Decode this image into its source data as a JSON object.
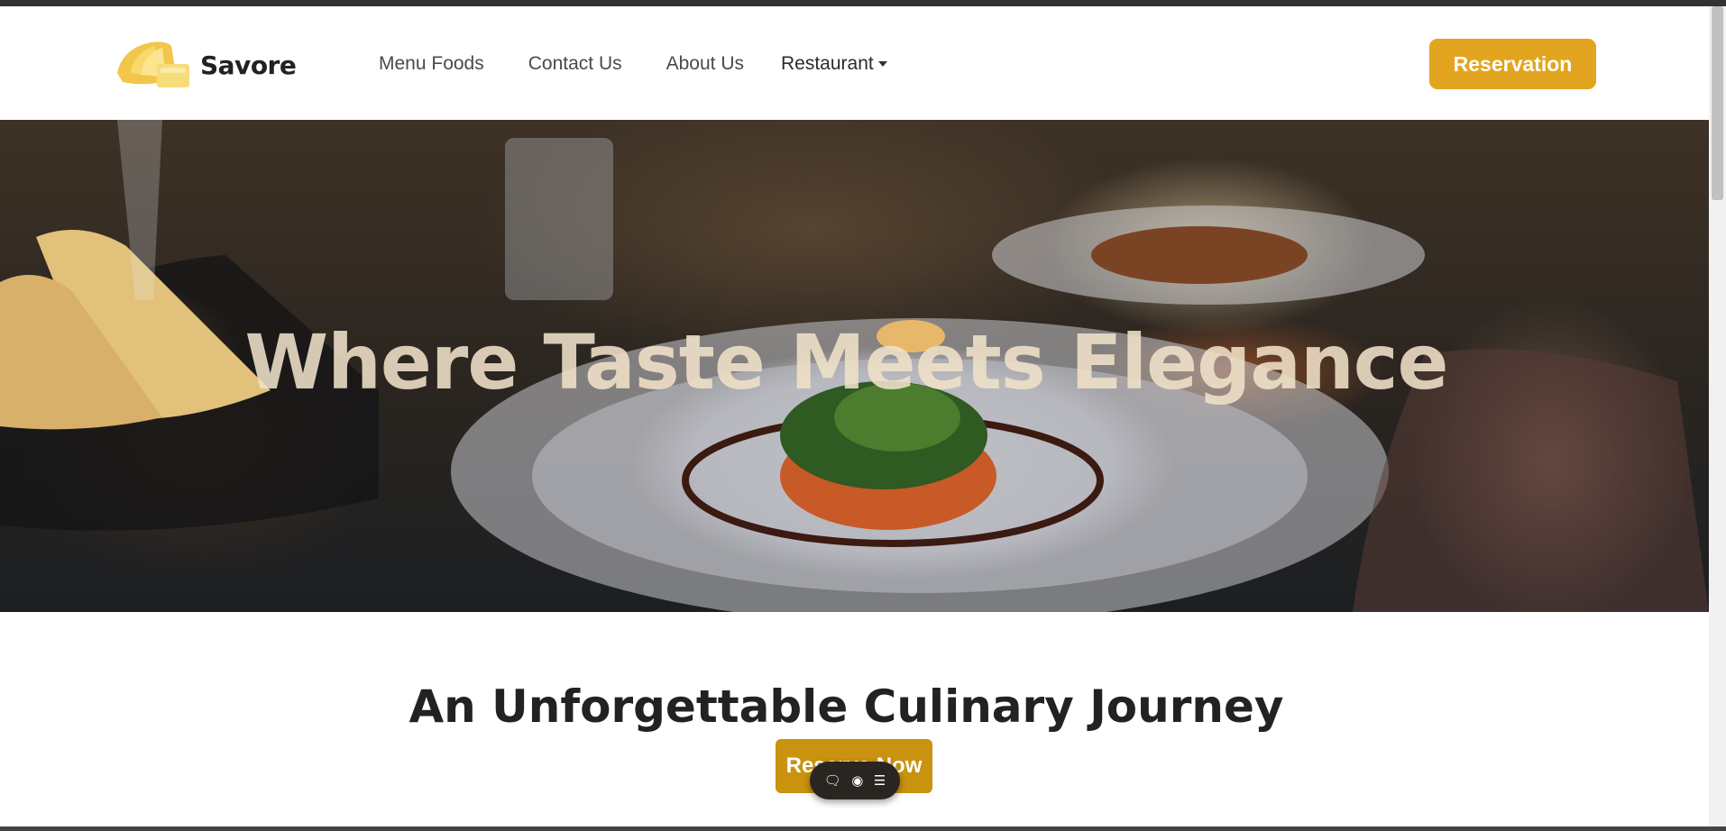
{
  "header": {
    "brand_name": "Savore",
    "logo_icon": "butter-logo-icon",
    "nav_items": [
      {
        "label": "Menu Foods"
      },
      {
        "label": "Contact Us"
      },
      {
        "label": "About Us"
      }
    ],
    "dropdown": {
      "label": "Restaurant"
    },
    "reservation_label": "Reservation"
  },
  "hero": {
    "title": "Where Taste Meets Elegance"
  },
  "content": {
    "heading": "An Unforgettable Culinary Journey",
    "cta_label": "Reserve Now"
  },
  "floating_toolbar": {
    "icons": [
      "comment-icon",
      "eye-icon",
      "list-icon"
    ]
  },
  "colors": {
    "accent": "#e3a51f",
    "cta": "#c9930f",
    "heading_text": "#222222",
    "hero_text": "#f0e1c8"
  }
}
